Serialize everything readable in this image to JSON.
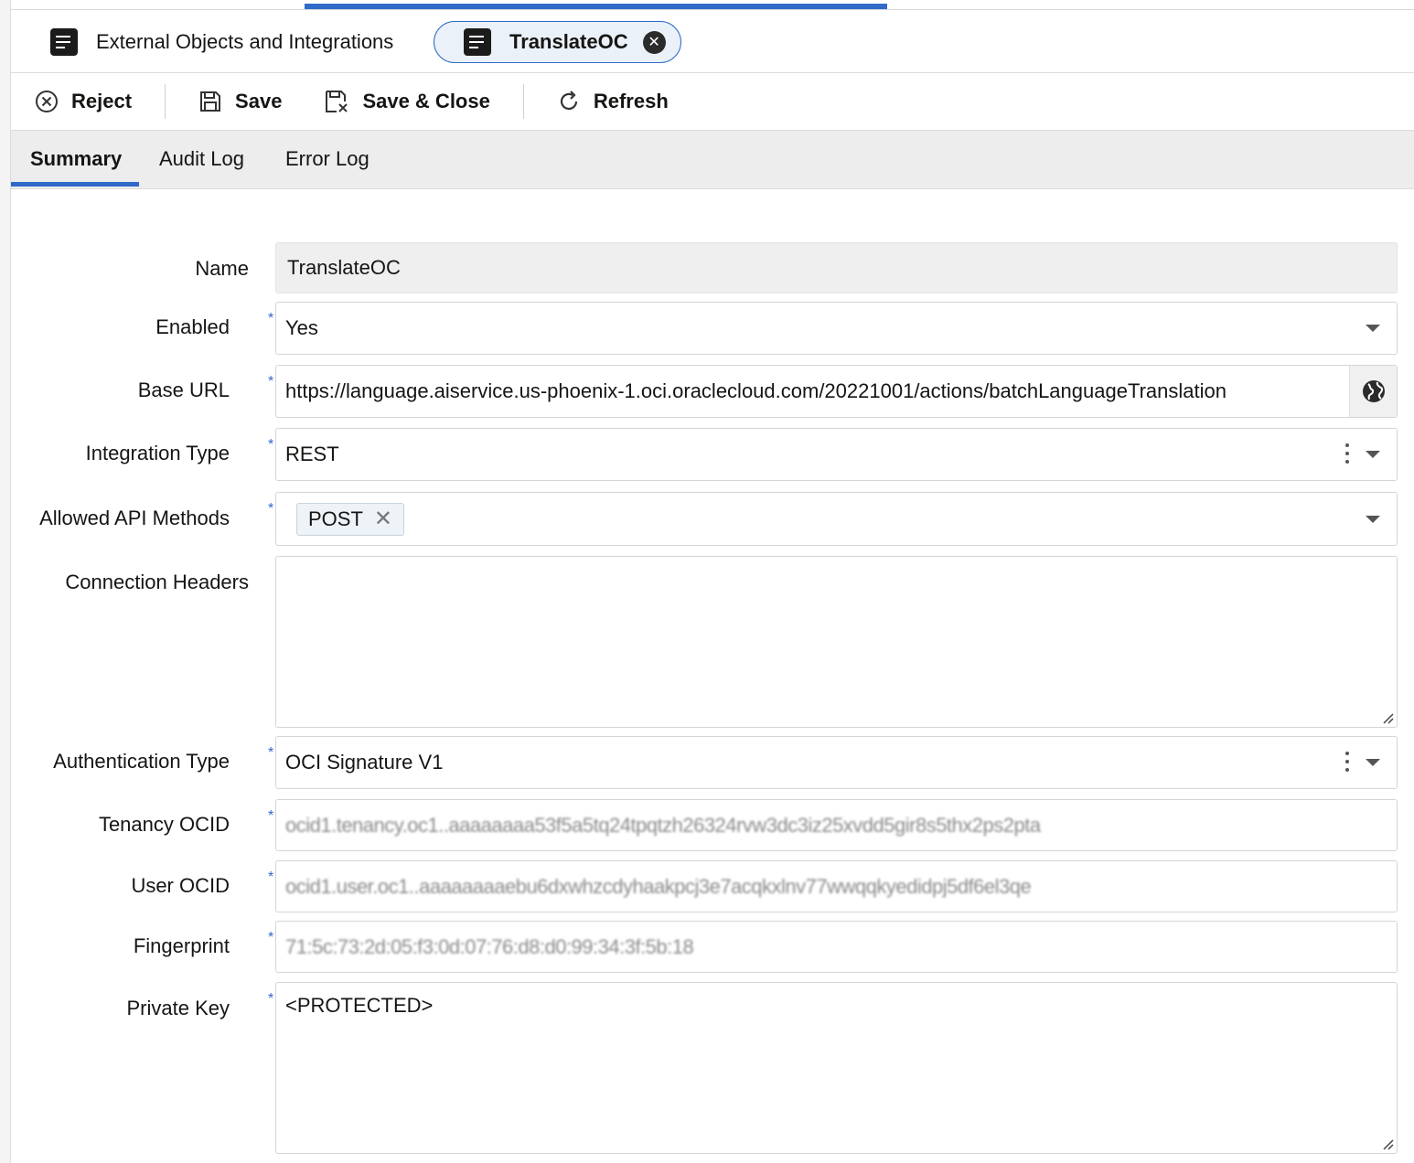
{
  "tabs": {
    "list_tab_label": "External Objects and Integrations",
    "active_tab_label": "TranslateOC"
  },
  "toolbar": {
    "reject": "Reject",
    "save": "Save",
    "save_close": "Save & Close",
    "refresh": "Refresh"
  },
  "subtabs": [
    "Summary",
    "Audit Log",
    "Error Log"
  ],
  "form": {
    "name_label": "Name",
    "name_value": "TranslateOC",
    "enabled_label": "Enabled",
    "enabled_value": "Yes",
    "base_url_label": "Base URL",
    "base_url_value": "https://language.aiservice.us-phoenix-1.oci.oraclecloud.com/20221001/actions/batchLanguageTranslation",
    "integration_type_label": "Integration Type",
    "integration_type_value": "REST",
    "allowed_methods_label": "Allowed API Methods",
    "allowed_methods": [
      "POST"
    ],
    "connection_headers_label": "Connection Headers",
    "connection_headers_value": "",
    "auth_type_label": "Authentication Type",
    "auth_type_value": "OCI Signature V1",
    "tenancy_label": "Tenancy OCID",
    "tenancy_value": "ocid1.tenancy.oc1..aaaaaaaa53f5a5tq24tpqtzh26324rvw3dc3iz25xvdd5gir8s5thx2ps2pta",
    "user_label": "User OCID",
    "user_value": "ocid1.user.oc1..aaaaaaaaebu6dxwhzcdyhaakpcj3e7acqkxlnv77wwqqkyedidpj5df6el3qe",
    "fingerprint_label": "Fingerprint",
    "fingerprint_value": "71:5c:73:2d:05:f3:0d:07:76:d8:d0:99:34:3f:5b:18",
    "private_key_label": "Private Key",
    "private_key_value": "<PROTECTED>"
  },
  "colors": {
    "accent": "#2f6ac8",
    "required_star": "#2f6ac8",
    "readonly_bg": "#efefef"
  }
}
